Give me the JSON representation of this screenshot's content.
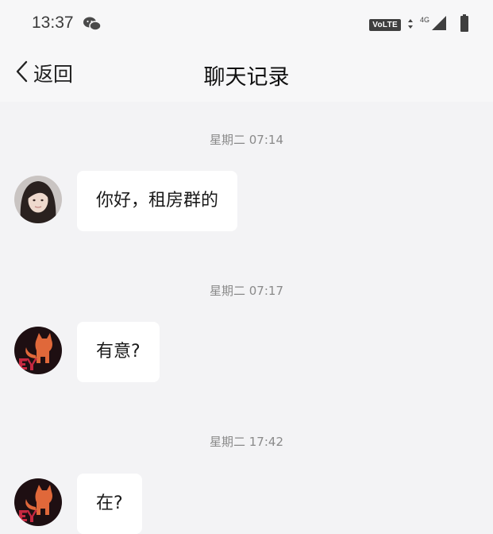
{
  "status_bar": {
    "time": "13:37",
    "wechat_icon": "wechat-icon",
    "volte": "VoLTE",
    "network": "4G",
    "signal_icon": "signal-icon",
    "battery_icon": "battery-icon"
  },
  "nav": {
    "back_label": "返回",
    "title": "聊天记录"
  },
  "messages": [
    {
      "timestamp": "星期二 07:14",
      "text": "你好，租房群的",
      "avatar": "woman-photo-avatar"
    },
    {
      "timestamp": "星期二 07:17",
      "text": "有意?",
      "avatar": "cat-logo-avatar"
    },
    {
      "timestamp": "星期二 17:42",
      "text": "在?",
      "avatar": "cat-logo-avatar"
    }
  ],
  "colors": {
    "background": "#f3f3f5",
    "bubble": "#ffffff",
    "timestamp": "#8a8a8a",
    "cat_avatar_bg": "#1e0f12",
    "cat_avatar_accent": "#e0683a"
  }
}
